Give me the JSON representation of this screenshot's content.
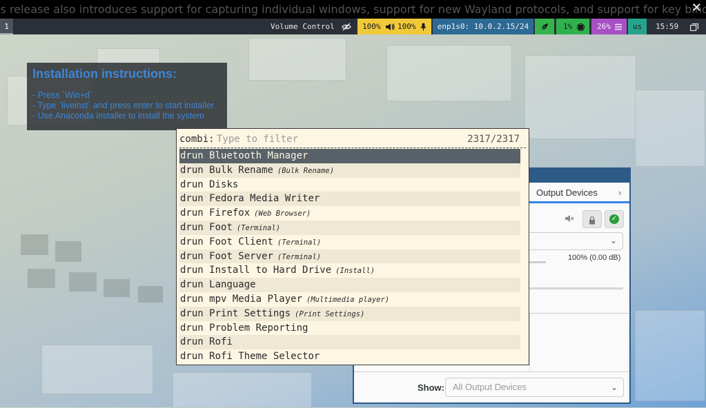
{
  "banner": {
    "text": "is release also introduces support for capturing individual windows, support for new Wayland protocols, and support for key bindings for playerctl.",
    "close_glyph": "✕"
  },
  "statusbar": {
    "workspace": "1",
    "window_title": "Volume Control",
    "idle_icon": "eye-slash-icon",
    "volume_out": "100%",
    "volume_in": "100%",
    "network": "enp1s0: 10.0.2.15/24",
    "cpu": "1%",
    "memory": "26%",
    "keyboard_layout": "us",
    "clock": "15:59",
    "colors": {
      "volume_bg": "#f0c93b",
      "network_bg": "#2d6a93",
      "power_bg": "#36b34d",
      "cpu_bg": "#2fb24d",
      "memory_bg": "#a84fc4",
      "kbd_bg": "#27a38c"
    }
  },
  "install_box": {
    "title": "Installation instructions:",
    "lines": [
      "- Press `Win+d`",
      "- Type `liveinst` and press enter to start installer",
      "- Use Anaconda installer to install the system"
    ]
  },
  "volume_window": {
    "tab_label": "Output Devices",
    "volume_readout": "100% (0.00 dB)",
    "show_label": "Show:",
    "show_value": "All Output Devices"
  },
  "rofi": {
    "prompt": "combi:",
    "filter_placeholder": "Type to filter",
    "count": "2317/2317",
    "items": [
      {
        "mode": "drun",
        "name": "Bluetooth Manager",
        "sub": ""
      },
      {
        "mode": "drun",
        "name": "Bulk Rename",
        "sub": "(Bulk Rename)"
      },
      {
        "mode": "drun",
        "name": "Disks",
        "sub": ""
      },
      {
        "mode": "drun",
        "name": "Fedora Media Writer",
        "sub": ""
      },
      {
        "mode": "drun",
        "name": "Firefox",
        "sub": "(Web Browser)"
      },
      {
        "mode": "drun",
        "name": "Foot",
        "sub": "(Terminal)"
      },
      {
        "mode": "drun",
        "name": "Foot Client",
        "sub": "(Terminal)"
      },
      {
        "mode": "drun",
        "name": "Foot Server",
        "sub": "(Terminal)"
      },
      {
        "mode": "drun",
        "name": "Install to Hard Drive",
        "sub": "(Install)"
      },
      {
        "mode": "drun",
        "name": "Language",
        "sub": ""
      },
      {
        "mode": "drun",
        "name": "mpv Media Player",
        "sub": "(Multimedia player)"
      },
      {
        "mode": "drun",
        "name": "Print Settings",
        "sub": "(Print Settings)"
      },
      {
        "mode": "drun",
        "name": "Problem Reporting",
        "sub": ""
      },
      {
        "mode": "drun",
        "name": "Rofi",
        "sub": ""
      },
      {
        "mode": "drun",
        "name": "Rofi Theme Selector",
        "sub": ""
      }
    ],
    "selected_index": 0
  }
}
